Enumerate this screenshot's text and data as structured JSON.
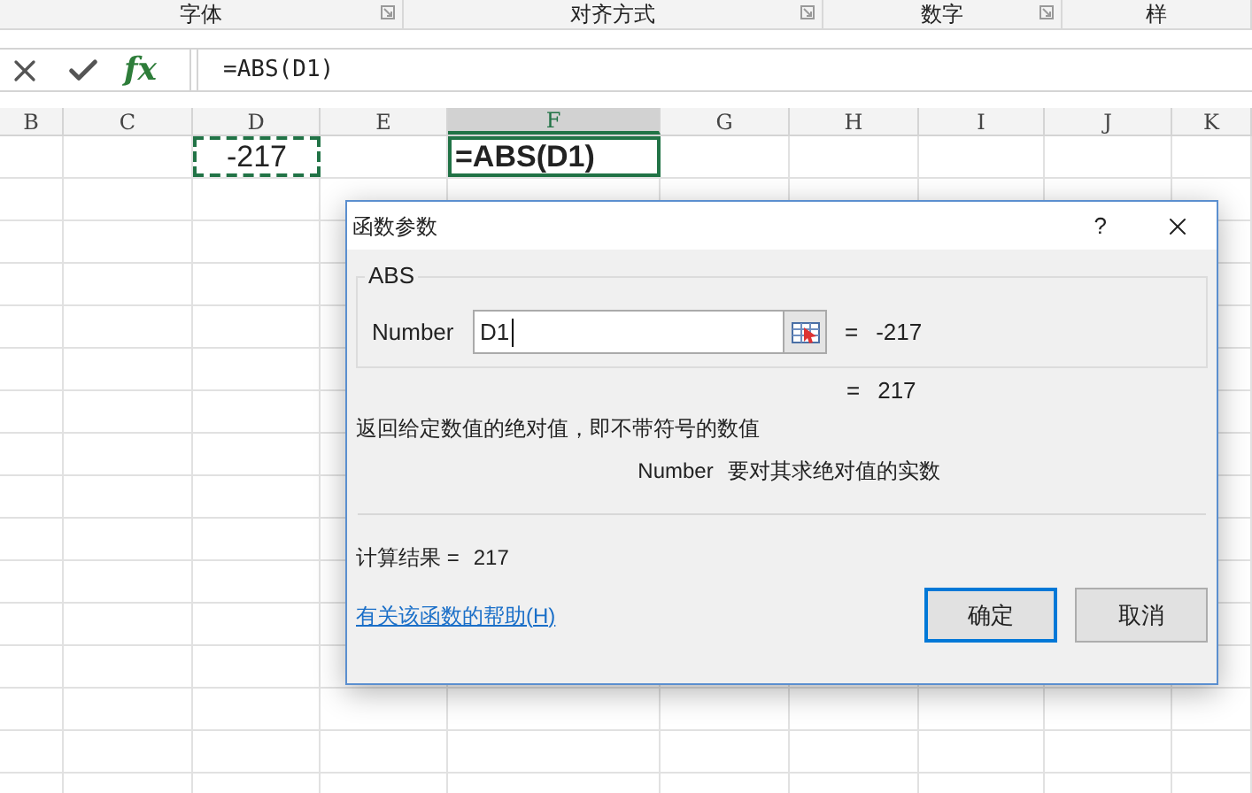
{
  "ribbon_groups": [
    {
      "label": "字体"
    },
    {
      "label": "对齐方式"
    },
    {
      "label": "数字"
    },
    {
      "label": "样"
    }
  ],
  "formula_bar": {
    "fx": "fx",
    "formula": "=ABS(D1)"
  },
  "columns": [
    {
      "label": "B",
      "selected": false
    },
    {
      "label": "C",
      "selected": false
    },
    {
      "label": "D",
      "selected": false
    },
    {
      "label": "E",
      "selected": false
    },
    {
      "label": "F",
      "selected": true
    },
    {
      "label": "G",
      "selected": false
    },
    {
      "label": "H",
      "selected": false
    },
    {
      "label": "I",
      "selected": false
    },
    {
      "label": "J",
      "selected": false
    },
    {
      "label": "K",
      "selected": false
    }
  ],
  "cells": [
    {
      "text": "-217",
      "kind": "copied"
    },
    {
      "text": "=ABS(D1)",
      "kind": "active"
    }
  ],
  "dialog": {
    "title": "函数参数",
    "help": "?",
    "function_name": "ABS",
    "argument": {
      "label": "Number",
      "value": "D1",
      "equals": "=",
      "result": "-217"
    },
    "result": {
      "equals": "=",
      "value": "217"
    },
    "description": "返回给定数值的绝对值，即不带符号的数值",
    "argument_help": {
      "name": "Number",
      "text": "要对其求绝对值的实数"
    },
    "calculation": {
      "label": "计算结果 =",
      "value": "217"
    },
    "help_link": "有关该函数的帮助(H)",
    "buttons": [
      {
        "label": "确定",
        "focused": true
      },
      {
        "label": "取消",
        "focused": false
      }
    ]
  }
}
